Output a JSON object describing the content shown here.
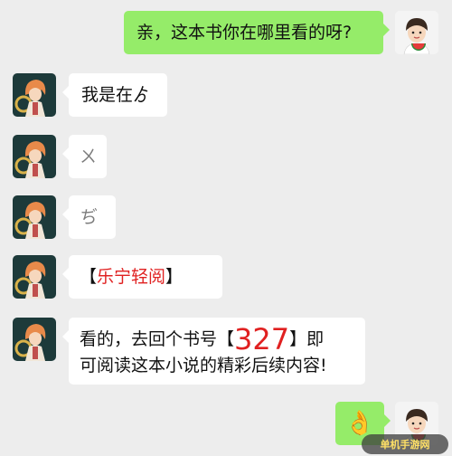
{
  "messages": [
    {
      "id": "m1",
      "side": "right",
      "text": "亲，这本书你在哪里看的呀?"
    },
    {
      "id": "m2",
      "side": "left",
      "text": "我是在ゟ"
    },
    {
      "id": "m3",
      "side": "left",
      "text": "ㄨ"
    },
    {
      "id": "m4",
      "side": "left",
      "text": "ぢ"
    },
    {
      "id": "m5",
      "side": "left",
      "bracket_open": "【",
      "app_name": "乐宁轻阅",
      "bracket_close": "】"
    },
    {
      "id": "m6",
      "side": "left",
      "line1_pre": "看的，去回个书号【",
      "book_code": "327",
      "line1_post": "】即",
      "line2": "可阅读这本小说的精彩后续内容!"
    },
    {
      "id": "m7",
      "side": "right",
      "emoji": "👌"
    }
  ],
  "watermark": "单机手游网",
  "colors": {
    "background": "#ededed",
    "sent_bubble": "#95ec69",
    "received_bubble": "#ffffff",
    "highlight": "#e02020"
  },
  "icons": {
    "user_avatar": "cartoon-girl-eating-watermelon",
    "contact_avatar": "anime-character-orange-hair"
  }
}
